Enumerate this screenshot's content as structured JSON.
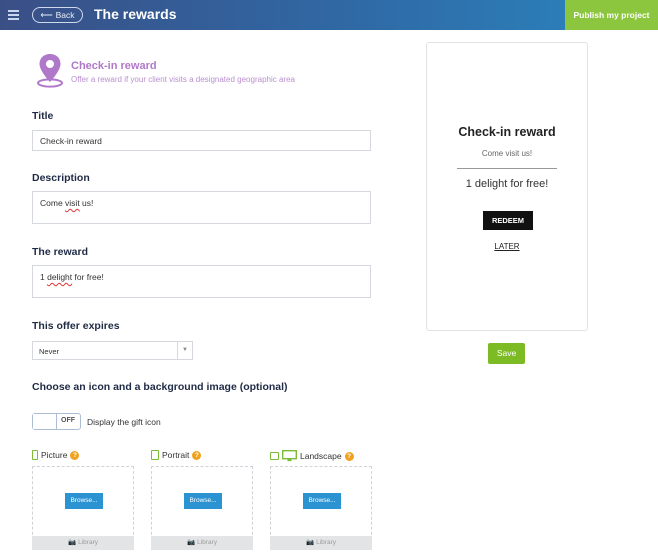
{
  "header": {
    "back_label": "Back",
    "title": "The rewards",
    "publish_label": "Publish my project"
  },
  "section": {
    "title": "Check-in reward",
    "subtitle": "Offer a reward if your client visits a designated geographic area",
    "icon": "map-pin-icon"
  },
  "form": {
    "title_label": "Title",
    "title_value": "Check-in reward",
    "description_label": "Description",
    "description_value_pre": "Come ",
    "description_value_mid": "visit",
    "description_value_post": " us!",
    "reward_label": "The reward",
    "reward_value_pre": "1 ",
    "reward_value_mid": "delight",
    "reward_value_post": " for free!",
    "expires_label": "This offer expires",
    "expires_value": "Never",
    "images_label": "Choose an icon and a background image (optional)",
    "toggle_state": "OFF",
    "toggle_label": "Display the gift icon"
  },
  "images": [
    {
      "label": "Picture",
      "browse": "Browse...",
      "library": "Library"
    },
    {
      "label": "Portrait",
      "browse": "Browse...",
      "library": "Library"
    },
    {
      "label": "Landscape",
      "browse": "Browse...",
      "library": "Library"
    }
  ],
  "preview": {
    "title": "Check-in reward",
    "subtitle": "Come visit us!",
    "reward": "1 delight for free!",
    "redeem": "REDEEM",
    "later": "LATER"
  },
  "save_label": "Save",
  "colors": {
    "accent_green": "#8cc63f",
    "section_purple": "#b078c8",
    "browse_blue": "#2b93d1",
    "help_orange": "#f0a21e"
  }
}
